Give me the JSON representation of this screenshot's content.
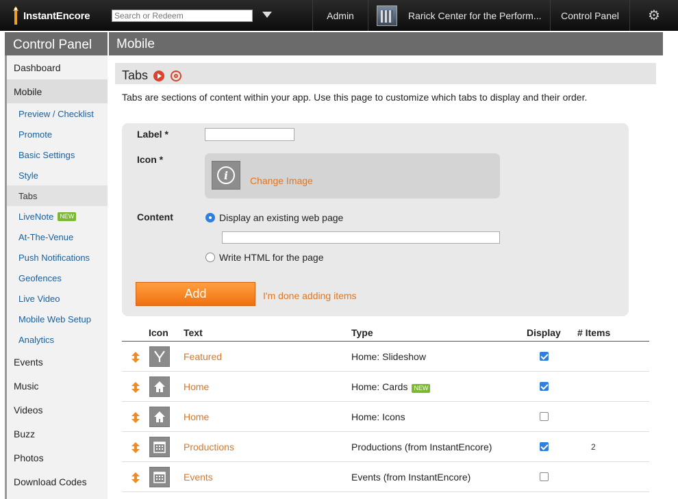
{
  "topbar": {
    "logo_text": "InstantEncore",
    "search_placeholder": "Search or Redeem",
    "admin": "Admin",
    "venue": "Rarick Center for the Perform...",
    "control_panel": "Control Panel",
    "gear_icon": "gear-icon"
  },
  "sidebar": {
    "title": "Control Panel",
    "dashboard": "Dashboard",
    "mobile": "Mobile",
    "sub_items": [
      {
        "label": "Preview / Checklist"
      },
      {
        "label": "Promote"
      },
      {
        "label": "Basic Settings"
      },
      {
        "label": "Style"
      },
      {
        "label": "Tabs"
      },
      {
        "label": "LiveNote",
        "badge": "NEW"
      },
      {
        "label": "At-The-Venue"
      },
      {
        "label": "Push Notifications"
      },
      {
        "label": "Geofences"
      },
      {
        "label": "Live Video"
      },
      {
        "label": "Mobile Web Setup"
      },
      {
        "label": "Analytics"
      }
    ],
    "items": [
      {
        "label": "Events"
      },
      {
        "label": "Music"
      },
      {
        "label": "Videos"
      },
      {
        "label": "Buzz"
      },
      {
        "label": "Photos"
      },
      {
        "label": "Download Codes"
      }
    ]
  },
  "main": {
    "title": "Mobile",
    "section_title": "Tabs",
    "description": "Tabs are sections of content within your app. Use this page to customize which tabs to display and their order."
  },
  "form": {
    "label_label": "Label *",
    "label_value": "",
    "icon_label": "Icon *",
    "change_image": "Change Image",
    "content_label": "Content",
    "option_web": "Display an existing web page",
    "option_html": "Write HTML for the page",
    "url_value": "",
    "selected_option": "web",
    "add_button": "Add",
    "done_link": "I'm done adding items"
  },
  "table": {
    "headers": {
      "icon": "Icon",
      "text": "Text",
      "type": "Type",
      "display": "Display",
      "items": "# Items"
    },
    "rows": [
      {
        "icon": "slideshow-icon",
        "text": "Featured",
        "type": "Home: Slideshow",
        "badge": "",
        "display": true,
        "items": ""
      },
      {
        "icon": "home-icon",
        "text": "Home",
        "type": "Home: Cards",
        "badge": "NEW",
        "display": true,
        "items": ""
      },
      {
        "icon": "home-icon",
        "text": "Home",
        "type": "Home: Icons",
        "badge": "",
        "display": false,
        "items": ""
      },
      {
        "icon": "calendar-icon",
        "text": "Productions",
        "type": "Productions (from InstantEncore)",
        "badge": "",
        "display": true,
        "items": "2"
      },
      {
        "icon": "calendar-icon",
        "text": "Events",
        "type": "Events (from InstantEncore)",
        "badge": "",
        "display": false,
        "items": ""
      }
    ]
  }
}
